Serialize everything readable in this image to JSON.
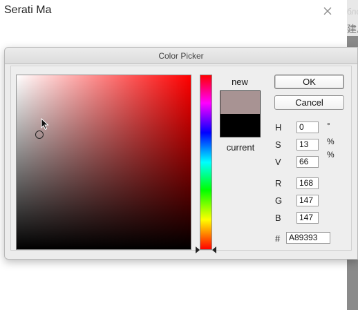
{
  "background_window": {
    "title": "Serati Ma",
    "right_fragment_top": "бло",
    "right_fragment_bottom": "建总"
  },
  "dialog": {
    "title": "Color Picker",
    "hue_color": "#ff0000",
    "marker_position": {
      "saturation": 0.13,
      "brightness": 0.66
    },
    "hue_position": 0,
    "swatch": {
      "new_label": "new",
      "current_label": "current",
      "new_color": "#A89393",
      "current_color": "#000000"
    },
    "buttons": {
      "ok": "OK",
      "cancel": "Cancel"
    },
    "hsb": {
      "h_label": "H",
      "h_value": "0",
      "h_unit": "°",
      "s_label": "S",
      "s_value": "13",
      "s_unit": "%",
      "b_label": "V",
      "b_value": "66",
      "b_unit": "%"
    },
    "rgb": {
      "r_label": "R",
      "r_value": "168",
      "g_label": "G",
      "g_value": "147",
      "b_label": "B",
      "b_value": "147"
    },
    "hex": {
      "label": "#",
      "value": "A89393"
    }
  }
}
